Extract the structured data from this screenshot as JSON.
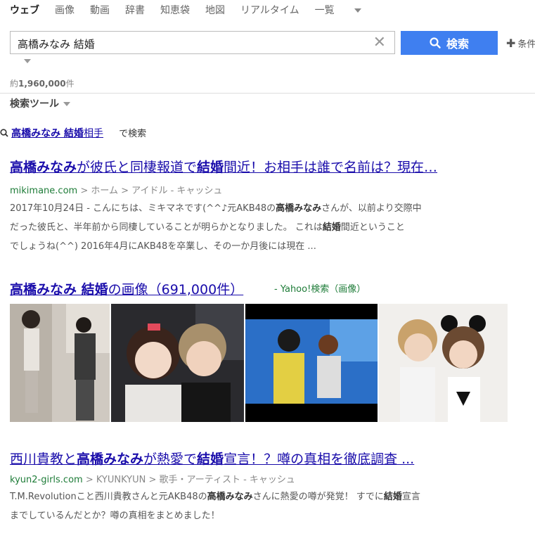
{
  "nav": {
    "items": [
      "ウェブ",
      "画像",
      "動画",
      "辞書",
      "知恵袋",
      "地図",
      "リアルタイム",
      "一覧"
    ]
  },
  "search": {
    "query": "高橋みなみ 結婚",
    "button_label": "検索",
    "options_label": "条件"
  },
  "count": {
    "prefix": "約",
    "number": "1,960,000",
    "suffix": "件"
  },
  "tools_label": "検索ツール",
  "suggest": {
    "query_bold": "高橋みなみ 結婚",
    "query_rest": "相手",
    "tail": "で検索"
  },
  "results": [
    {
      "title_parts": [
        {
          "t": "高橋みなみ",
          "b": true
        },
        {
          "t": "が彼氏と同棲報道で",
          "b": false
        },
        {
          "t": "結婚",
          "b": true
        },
        {
          "t": "間近！お相手は誰で名前は？現在…",
          "b": false
        }
      ],
      "url": "mikimane.com",
      "crumb": "> ホーム > アイドル - キャッシュ",
      "snippet_lines": [
        [
          {
            "t": "2017年10月24日 - こんにちは、ミキマネです(^^♪元AKB48の",
            "b": false
          },
          {
            "t": "高橋みなみ",
            "b": true
          },
          {
            "t": "さんが、以前より交際中",
            "b": false
          }
        ],
        [
          {
            "t": "だった彼氏と、半年前から同棲していることが明らかとなりました。 これは",
            "b": false
          },
          {
            "t": "結婚",
            "b": true
          },
          {
            "t": "間近ということ",
            "b": false
          }
        ],
        [
          {
            "t": "でしょうね(^^) 2016年4月にAKB48を卒業し、その一か月後には現在 ...",
            "b": false
          }
        ]
      ]
    },
    {
      "title_parts": [
        {
          "t": "西川貴教と",
          "b": false
        },
        {
          "t": "高橋みなみ",
          "b": true
        },
        {
          "t": "が熱愛で",
          "b": false
        },
        {
          "t": "結婚",
          "b": true
        },
        {
          "t": "宣言！？噂の真相を徹底調査 ...",
          "b": false
        }
      ],
      "url": "kyun2-girls.com",
      "crumb": "> KYUNKYUN > 歌手・アーティスト - キャッシュ",
      "snippet_lines": [
        [
          {
            "t": "T.M.Revolutionこと西川貴教さんと元AKB48の",
            "b": false
          },
          {
            "t": "高橋みなみ",
            "b": true
          },
          {
            "t": "さんに熱愛の噂が発覚！ すでに",
            "b": false
          },
          {
            "t": "結婚",
            "b": true
          },
          {
            "t": "宣言",
            "b": false
          }
        ],
        [
          {
            "t": "までしているんだとか？噂の真相をまとめました！",
            "b": false
          }
        ]
      ]
    }
  ],
  "images": {
    "title_bold": "高橋みなみ 結婚",
    "title_rest": "の画像（691,000件）",
    "source": "- Yahoo!検索（画像）",
    "thumbs": [
      "couple-walking-photo",
      "selfie-photo",
      "tv-show-photo",
      "duo-photo"
    ]
  }
}
